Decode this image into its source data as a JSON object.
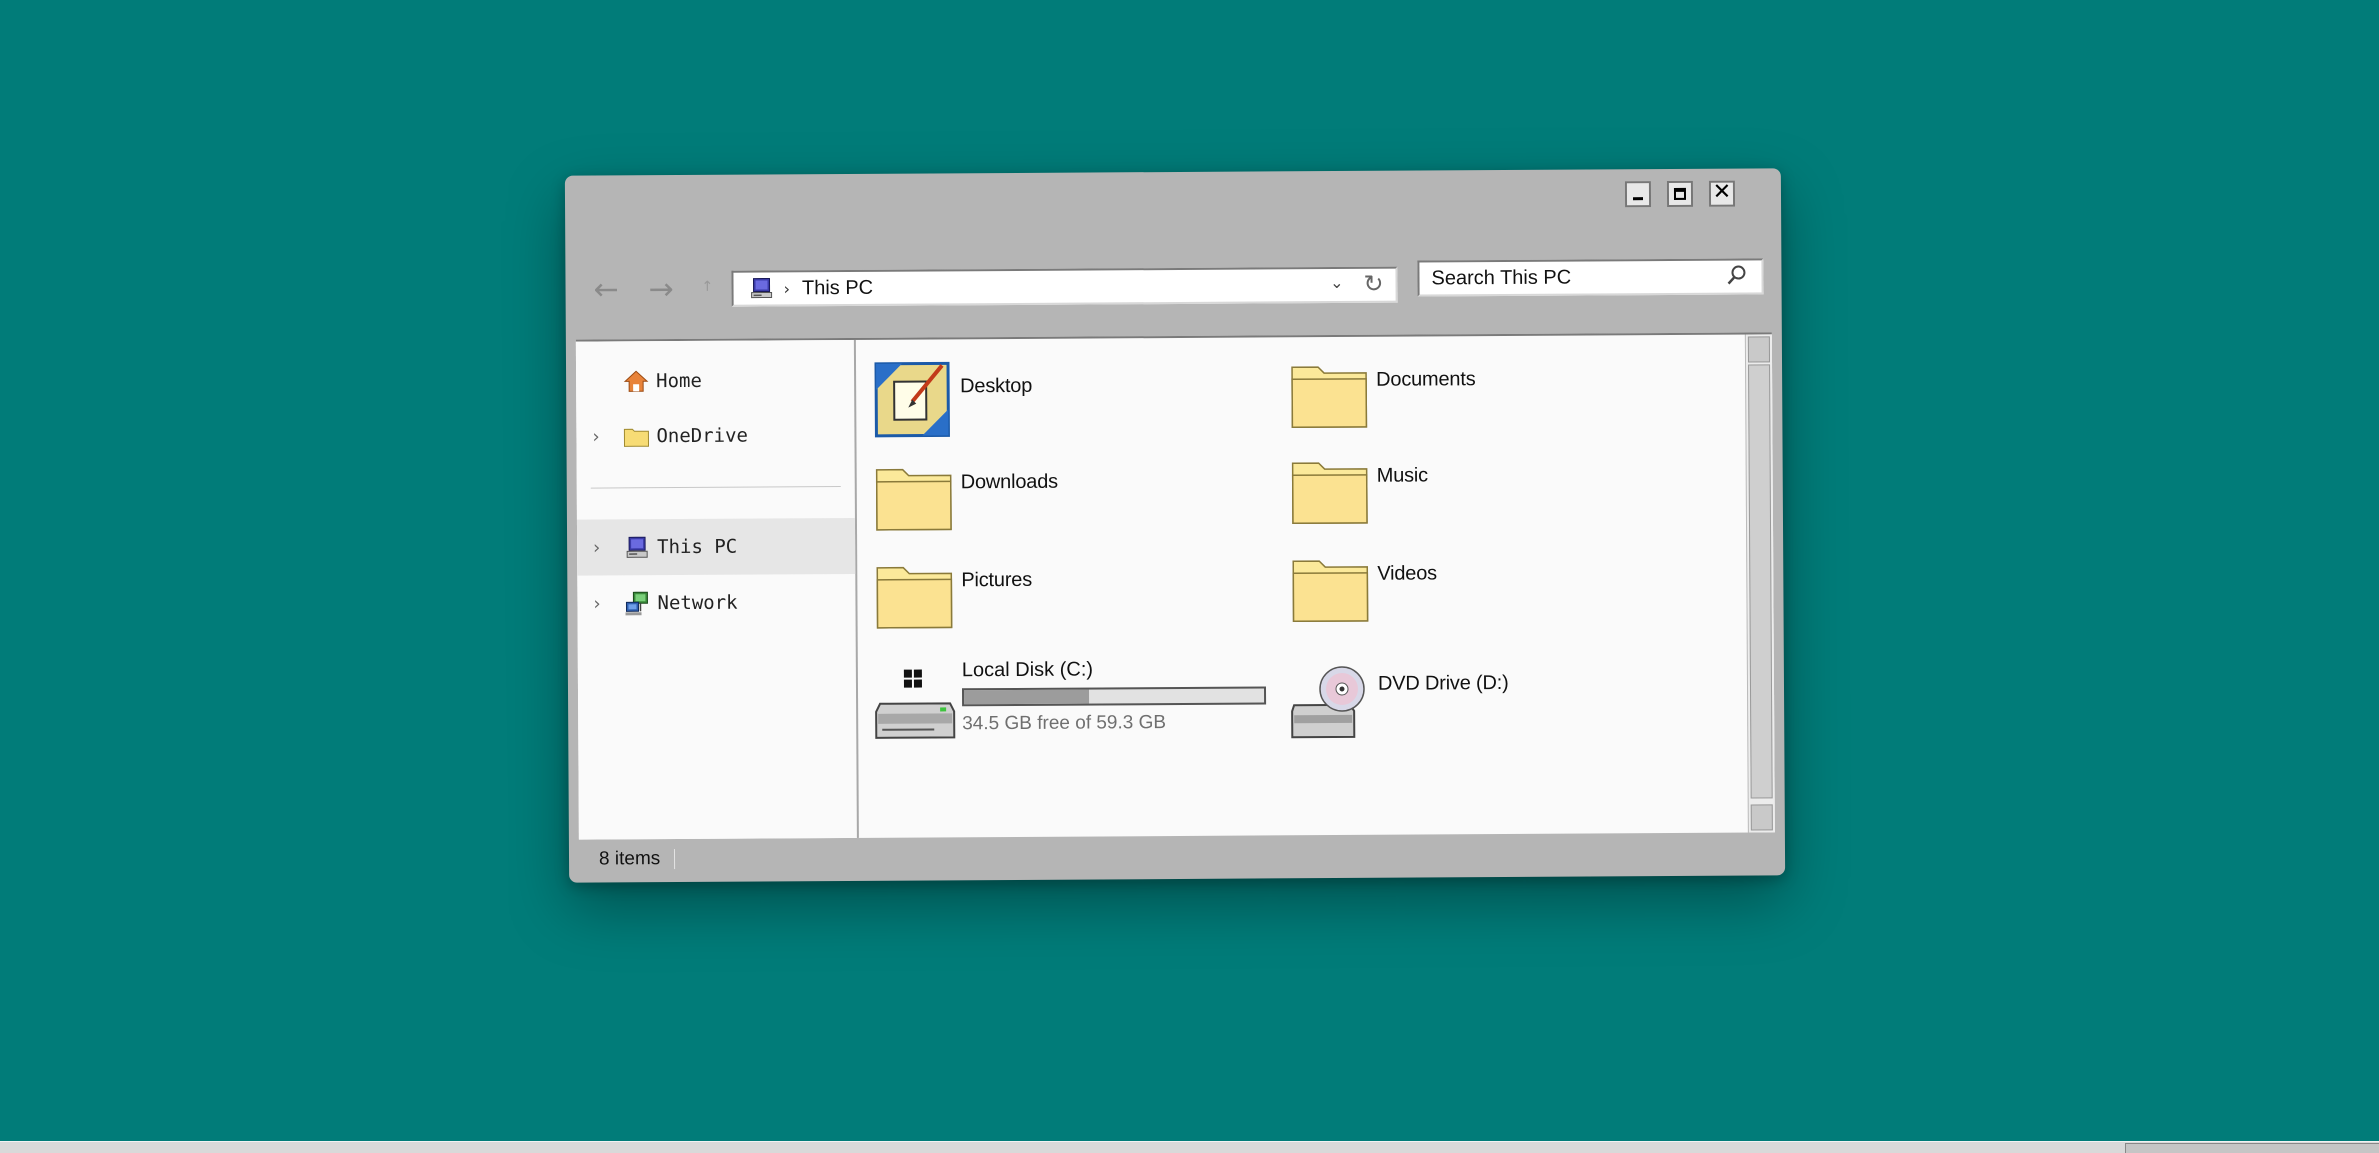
{
  "window": {
    "controls": {
      "minimize_label": "",
      "maximize_label": "",
      "close_label": "✕"
    }
  },
  "nav": {
    "back_icon": "←",
    "forward_icon": "→",
    "up_icon": "↑"
  },
  "address": {
    "icon": "this-pc-icon",
    "separator": "›",
    "path": "This PC",
    "dropdown_icon": "⌄",
    "refresh_icon": "↻"
  },
  "search": {
    "placeholder": "Search This PC",
    "icon": "search-icon"
  },
  "sidebar": {
    "items": [
      {
        "label": "Home",
        "icon": "home-icon",
        "expandable": false,
        "selected": false
      },
      {
        "label": "OneDrive",
        "icon": "folder-icon",
        "expandable": true,
        "selected": false
      },
      {
        "label": "This PC",
        "icon": "this-pc-icon",
        "expandable": true,
        "selected": true
      },
      {
        "label": "Network",
        "icon": "network-icon",
        "expandable": true,
        "selected": false
      }
    ],
    "chevron": "›"
  },
  "main": {
    "folders": [
      {
        "label": "Desktop",
        "icon": "desktop-icon"
      },
      {
        "label": "Documents",
        "icon": "folder-icon"
      },
      {
        "label": "Downloads",
        "icon": "folder-icon"
      },
      {
        "label": "Music",
        "icon": "folder-icon"
      },
      {
        "label": "Pictures",
        "icon": "folder-icon"
      },
      {
        "label": "Videos",
        "icon": "folder-icon"
      }
    ],
    "drives": [
      {
        "label": "Local Disk (C:)",
        "icon": "local-disk-icon",
        "free_text": "34.5 GB free of 59.3 GB",
        "used_fraction": 0.418
      },
      {
        "label": "DVD Drive (D:)",
        "icon": "dvd-drive-icon"
      }
    ]
  },
  "status": {
    "item_count": "8 items"
  },
  "colors": {
    "desktop": "#017c79",
    "window_frame": "#b5b5b5",
    "content_bg": "#fafafa",
    "folder_yellow": "#fbe99a",
    "selected_bg": "#e6e6e6"
  }
}
